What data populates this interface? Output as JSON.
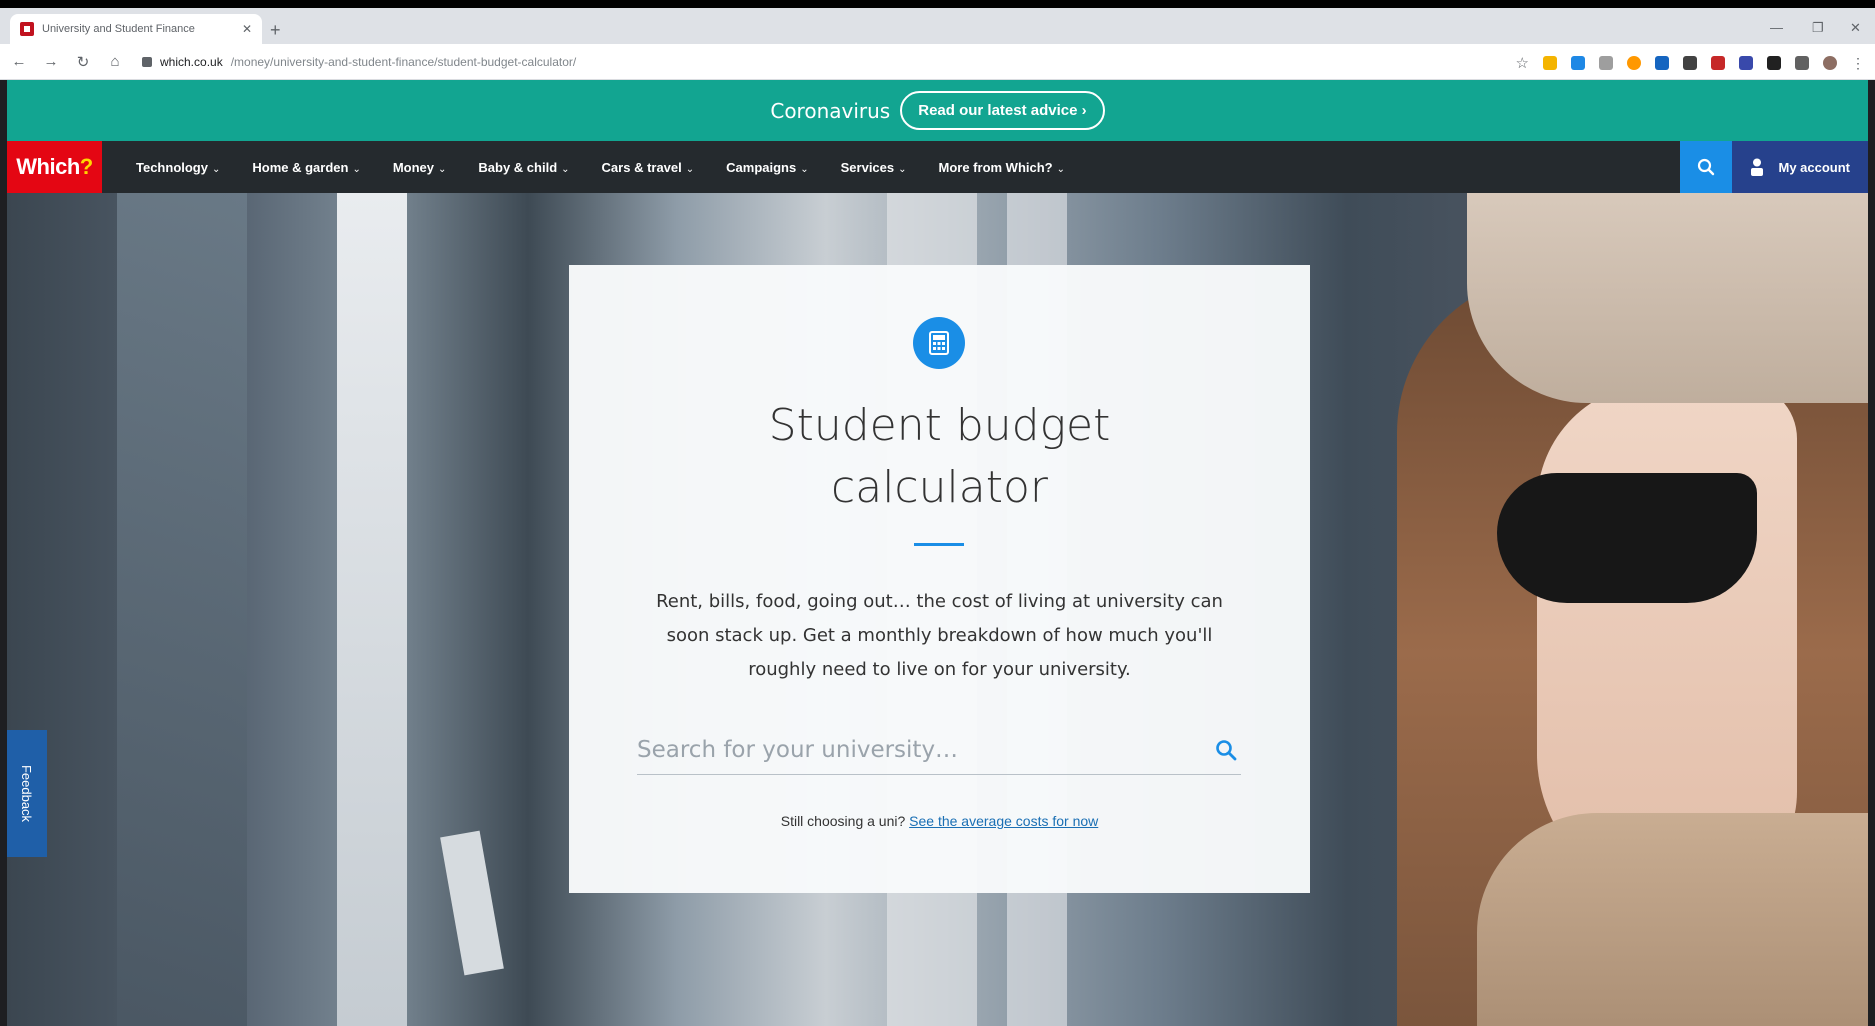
{
  "browser": {
    "tab_title": "University and Student Finance",
    "url_host": "which.co.uk",
    "url_path": "/money/university-and-student-finance/student-budget-calculator/"
  },
  "banner": {
    "text": "Coronavirus",
    "button": "Read our latest advice ›"
  },
  "nav": {
    "logo": "Which",
    "logo_mark": "?",
    "items": [
      {
        "label": "Technology"
      },
      {
        "label": "Home & garden"
      },
      {
        "label": "Money"
      },
      {
        "label": "Baby & child"
      },
      {
        "label": "Cars & travel"
      },
      {
        "label": "Campaigns"
      },
      {
        "label": "Services"
      },
      {
        "label": "More from Which?"
      }
    ],
    "account": "My account"
  },
  "card": {
    "title_line1": "Student budget",
    "title_line2": "calculator",
    "intro": "Rent, bills, food, going out… the cost of living at university can soon stack up. Get a monthly breakdown of how much you'll roughly need to live on for your university.",
    "search_placeholder": "Search for your university…",
    "still_prefix": "Still choosing a uni?",
    "still_link": "See the average costs for now"
  },
  "feedback": "Feedback",
  "colors": {
    "banner": "#12a591",
    "nav": "#252a2e",
    "logo": "#e40613",
    "accent_blue": "#1a8ee6",
    "account": "#26418c"
  }
}
